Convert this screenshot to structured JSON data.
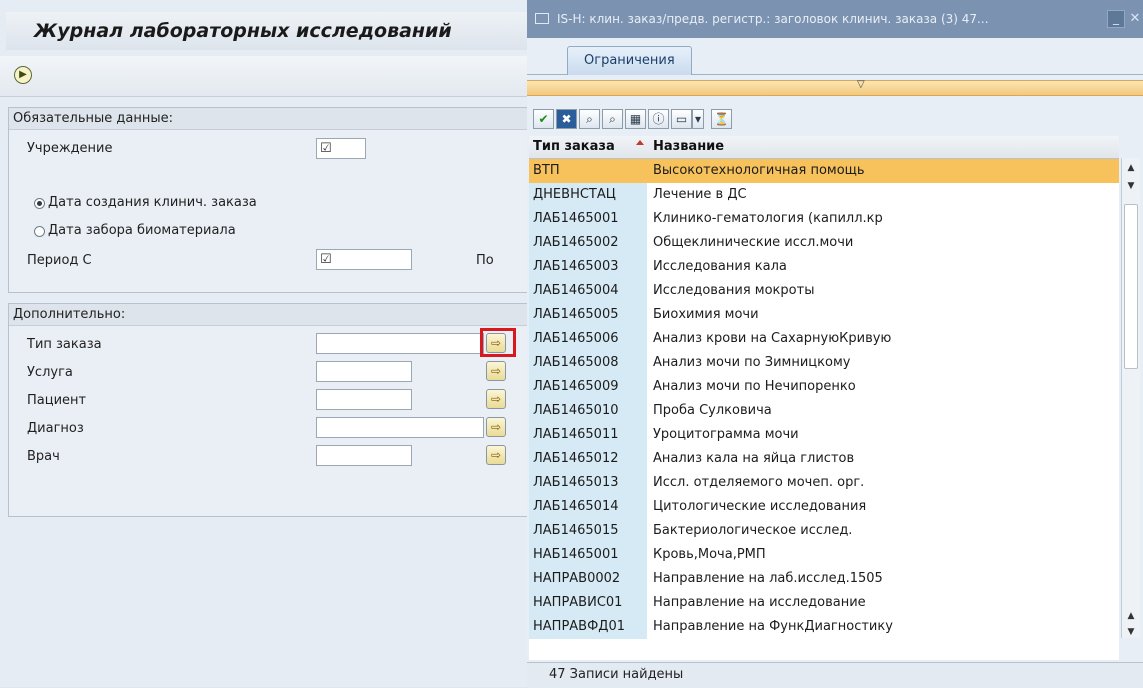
{
  "main": {
    "title": "Журнал лабораторных исследований",
    "exec_icon": "execute-icon",
    "required_group": {
      "header": "Обязательные данные:",
      "institution_label": "Учреждение",
      "radio_created": "Дата создания клинич. заказа",
      "radio_collected": "Дата забора биоматериала",
      "period_from_label": "Период С",
      "period_to_label": "По",
      "required_mark": "☑"
    },
    "additional_group": {
      "header": "Дополнительно:",
      "order_type_label": "Тип заказа",
      "service_label": "Услуга",
      "patient_label": "Пациент",
      "diagnosis_label": "Диагноз",
      "doctor_label": "Врач",
      "multi_select_glyph": "⇨"
    }
  },
  "popup": {
    "title": "IS-H: клин. заказ/предв. регистр.: заголовок клинич. заказа (3)   47...",
    "tab_label": "Ограничения",
    "orange_bar_marker": "▽",
    "toolbar_icons": [
      "checkmark-icon",
      "cancel-icon",
      "find-icon",
      "find-next-icon",
      "settings-icon",
      "info-icon",
      "print-icon",
      "dropdown-icon",
      "filter-icon"
    ],
    "grid": {
      "headers": [
        "Тип заказа",
        "Название"
      ],
      "rows": [
        {
          "code": "ВТП",
          "name": "Высокотехнологичная помощь"
        },
        {
          "code": "ДНЕВНСТАЦ",
          "name": "Лечение в ДС"
        },
        {
          "code": "ЛАБ1465001",
          "name": "Клинико-гематология (капилл.кр"
        },
        {
          "code": "ЛАБ1465002",
          "name": "Общеклинические иссл.мочи"
        },
        {
          "code": "ЛАБ1465003",
          "name": "Исследования кала"
        },
        {
          "code": "ЛАБ1465004",
          "name": "Исследования мокроты"
        },
        {
          "code": "ЛАБ1465005",
          "name": "Биохимия мочи"
        },
        {
          "code": "ЛАБ1465006",
          "name": "Анализ крови на СахарнуюКривую"
        },
        {
          "code": "ЛАБ1465008",
          "name": "Анализ мочи по Зимницкому"
        },
        {
          "code": "ЛАБ1465009",
          "name": "Анализ мочи по Нечипоренко"
        },
        {
          "code": "ЛАБ1465010",
          "name": "Проба Сулковича"
        },
        {
          "code": "ЛАБ1465011",
          "name": "Уроцитограмма мочи"
        },
        {
          "code": "ЛАБ1465012",
          "name": "Анализ кала на яйца глистов"
        },
        {
          "code": "ЛАБ1465013",
          "name": "Иссл. отделяемого мочеп. орг."
        },
        {
          "code": "ЛАБ1465014",
          "name": "Цитологические исследования"
        },
        {
          "code": "ЛАБ1465015",
          "name": "Бактериологическое исслед."
        },
        {
          "code": "НАБ1465001",
          "name": "Кровь,Моча,РМП"
        },
        {
          "code": "НАПРАВ0002",
          "name": "Направление на лаб.исслед.1505"
        },
        {
          "code": "НАПРАВИС01",
          "name": "Направление на исследование"
        },
        {
          "code": "НАПРАВФД01",
          "name": "Направление на ФункДиагностику"
        }
      ]
    },
    "status_text": "47 Записи найдены"
  }
}
